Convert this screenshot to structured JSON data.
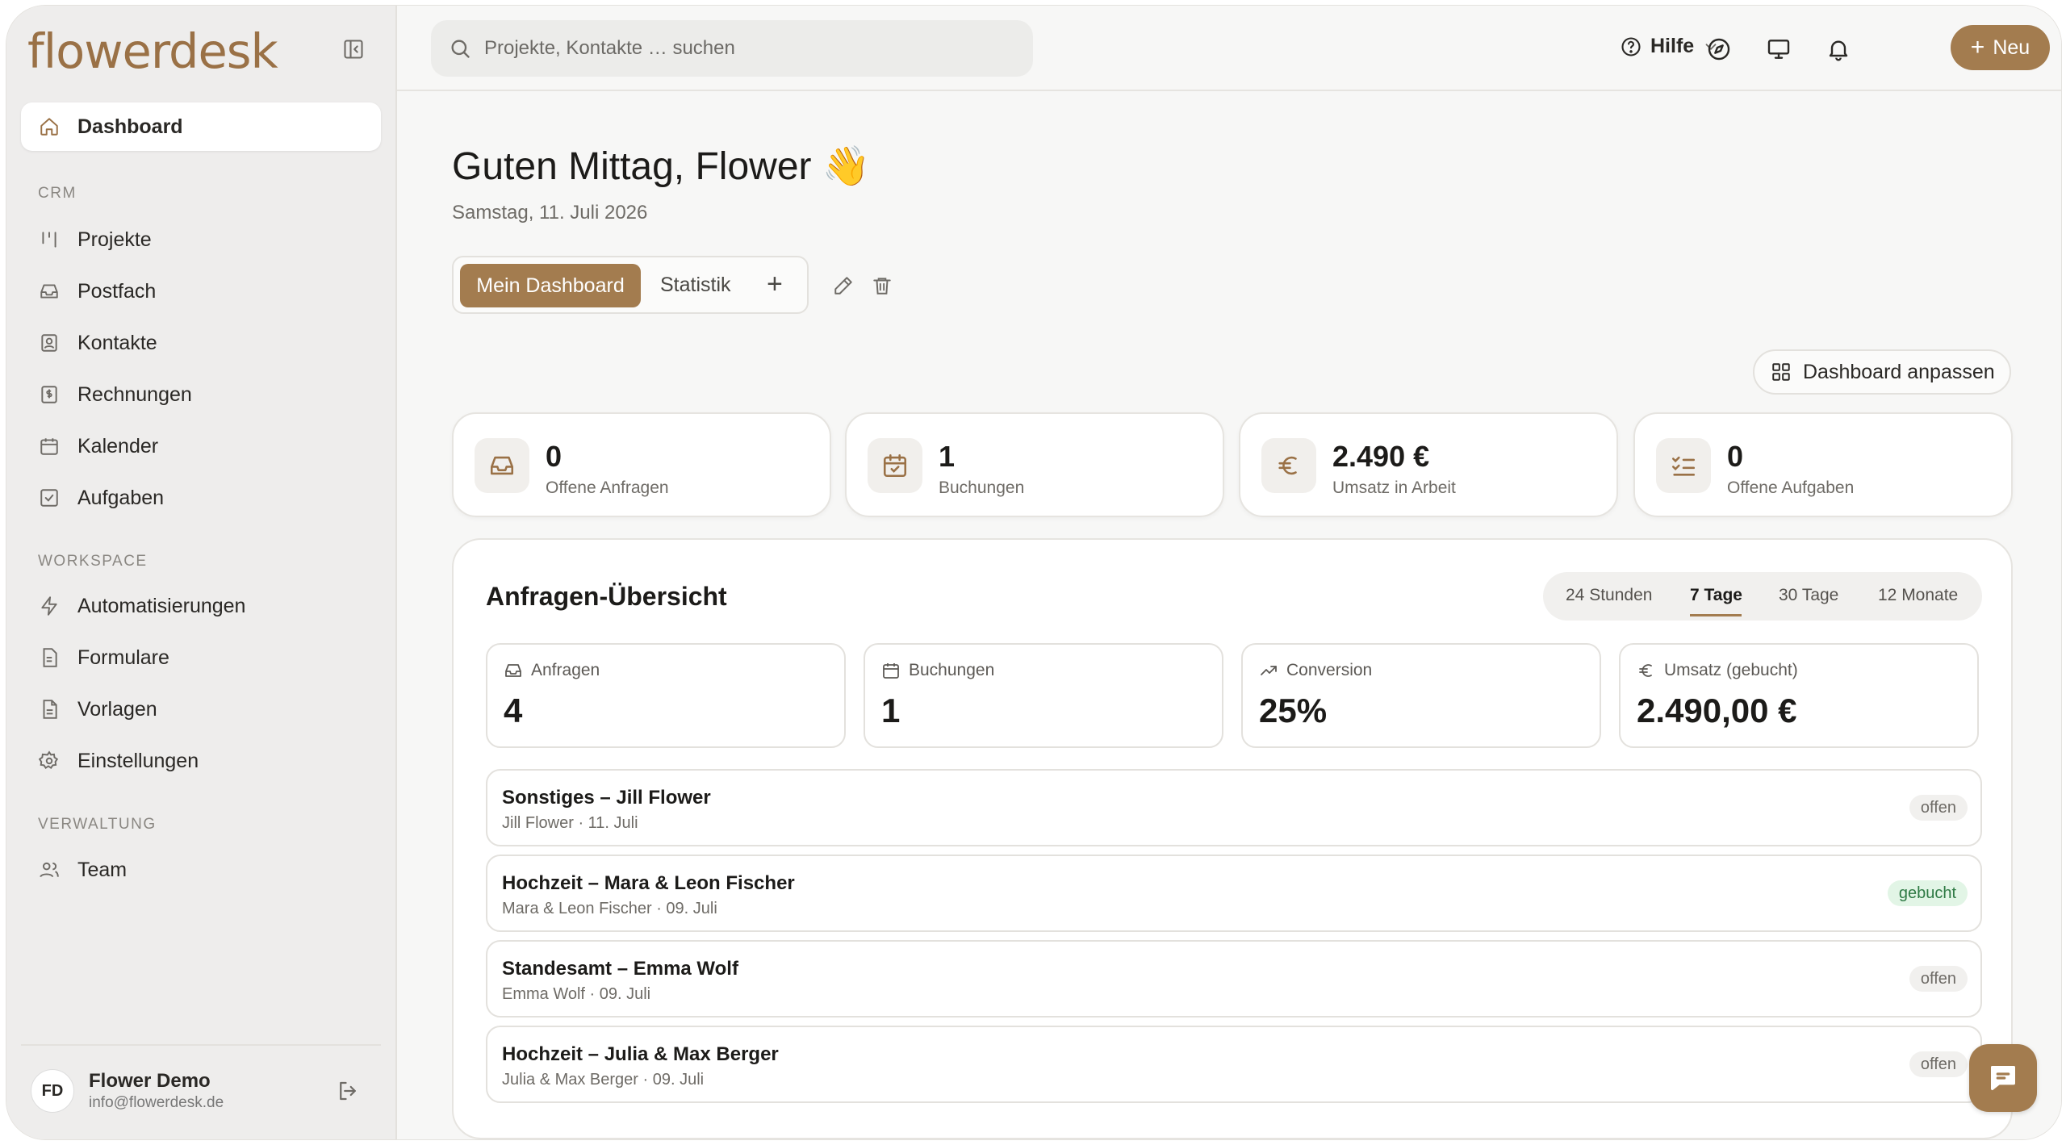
{
  "brand": {
    "name": "flowerdesk"
  },
  "sidebar": {
    "active": {
      "label": "Dashboard",
      "icon": "home-icon"
    },
    "sections": [
      {
        "label": "CRM",
        "items": [
          {
            "label": "Projekte",
            "icon": "kanban-icon"
          },
          {
            "label": "Postfach",
            "icon": "inbox-icon"
          },
          {
            "label": "Kontakte",
            "icon": "contact-icon"
          },
          {
            "label": "Rechnungen",
            "icon": "invoice-icon"
          },
          {
            "label": "Kalender",
            "icon": "calendar-icon"
          },
          {
            "label": "Aufgaben",
            "icon": "checkbox-icon"
          }
        ]
      },
      {
        "label": "WORKSPACE",
        "items": [
          {
            "label": "Automatisierungen",
            "icon": "zap-icon"
          },
          {
            "label": "Formulare",
            "icon": "form-icon"
          },
          {
            "label": "Vorlagen",
            "icon": "template-icon"
          },
          {
            "label": "Einstellungen",
            "icon": "gear-icon"
          }
        ]
      },
      {
        "label": "VERWALTUNG",
        "items": [
          {
            "label": "Team",
            "icon": "users-icon"
          }
        ]
      }
    ],
    "user": {
      "initials": "FD",
      "name": "Flower Demo",
      "email": "info@flowerdesk.de"
    }
  },
  "topbar": {
    "search_placeholder": "Projekte, Kontakte … suchen",
    "help_label": "Hilfe",
    "new_label": "Neu"
  },
  "greeting": {
    "title": "Guten Mittag, Flower 👋",
    "date": "Samstag, 11. Juli 2026"
  },
  "dashboard_tabs": {
    "active": "Mein Dashboard",
    "other": "Statistik",
    "add": "+"
  },
  "customize_label": "Dashboard anpassen",
  "kpis": [
    {
      "value": "0",
      "label": "Offene Anfragen",
      "icon": "inbox-icon"
    },
    {
      "value": "1",
      "label": "Buchungen",
      "icon": "calendar-check-icon"
    },
    {
      "value": "2.490 €",
      "label": "Umsatz in Arbeit",
      "icon": "euro-icon"
    },
    {
      "value": "0",
      "label": "Offene Aufgaben",
      "icon": "checklist-icon"
    }
  ],
  "overview": {
    "title": "Anfragen-Übersicht",
    "ranges": [
      "24 Stunden",
      "7 Tage",
      "30 Tage",
      "12 Monate"
    ],
    "selected_range": "7 Tage",
    "stats": [
      {
        "label": "Anfragen",
        "value": "4",
        "icon": "inbox-icon"
      },
      {
        "label": "Buchungen",
        "value": "1",
        "icon": "calendar-icon"
      },
      {
        "label": "Conversion",
        "value": "25%",
        "icon": "trending-up-icon"
      },
      {
        "label": "Umsatz (gebucht)",
        "value": "2.490,00 €",
        "icon": "euro-icon"
      }
    ],
    "requests": [
      {
        "title": "Sonstiges – Jill Flower",
        "sub": "Jill Flower · 11. Juli",
        "status": "offen"
      },
      {
        "title": "Hochzeit – Mara & Leon Fischer",
        "sub": "Mara & Leon Fischer · 09. Juli",
        "status": "gebucht"
      },
      {
        "title": "Standesamt – Emma Wolf",
        "sub": "Emma Wolf · 09. Juli",
        "status": "offen"
      },
      {
        "title": "Hochzeit – Julia & Max Berger",
        "sub": "Julia & Max Berger · 09. Juli",
        "status": "offen"
      }
    ]
  },
  "colors": {
    "accent": "#a37c4f",
    "sidebar_bg": "#eeedec",
    "booked_bg": "#e2f5e6",
    "booked_fg": "#2e7a44"
  }
}
